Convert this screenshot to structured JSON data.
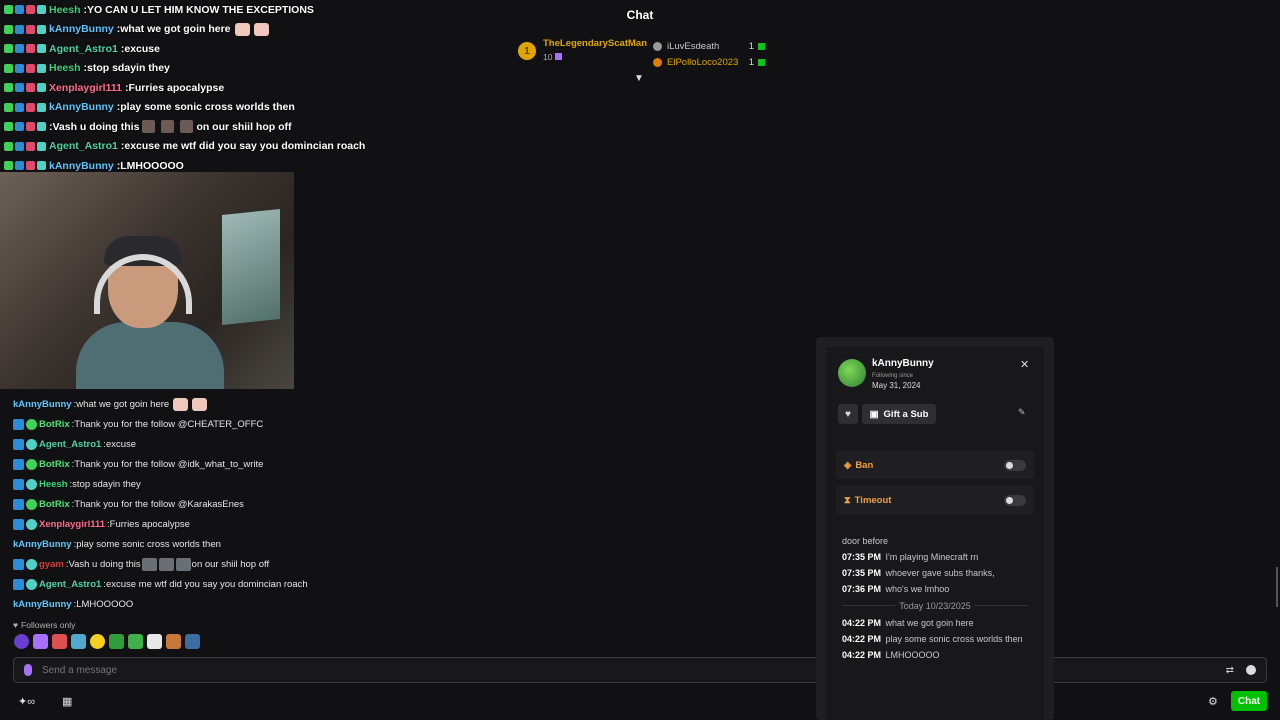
{
  "header": {
    "title": "Chat"
  },
  "overlay_chat": [
    {
      "name": "Heesh",
      "name_color": "#39d17c",
      "text": "YO CAN U LET HIM KNOW THE EXCEPTIONS"
    },
    {
      "name": "kAnnyBunny",
      "name_color": "#5fc6ff",
      "text": "what we got goin here"
    },
    {
      "name": "Agent_Astro1",
      "name_color": "#4fd1a5",
      "text": "excuse"
    },
    {
      "name": "Heesh",
      "name_color": "#39d17c",
      "text": "stop sdayin they"
    },
    {
      "name": "Xenplaygirl111",
      "name_color": "#ff6b8a",
      "text": "Furries apocalypse"
    },
    {
      "name": "kAnnyBunny",
      "name_color": "#5fc6ff",
      "text": "play some sonic cross worlds then"
    },
    {
      "name": "",
      "name_color": "#ffffff",
      "text": "Vash u doing this",
      "text2": "on our shiil hop off"
    },
    {
      "name": "Agent_Astro1",
      "name_color": "#4fd1a5",
      "text": "excuse me wtf did you say you domincian roach"
    },
    {
      "name": "kAnnyBunny",
      "name_color": "#5fc6ff",
      "text": "LMHOOOOO"
    }
  ],
  "leaderboard": {
    "top": {
      "rank": "1",
      "name": "TheLegendaryScatMan",
      "points": "10"
    },
    "others": [
      {
        "name": "iLuvEsdeath",
        "count": "1",
        "name_color": "#c8c8c8",
        "icon_color": "#9a9a9a"
      },
      {
        "name": "ElPolloLoco2023",
        "count": "1",
        "name_color": "#e0a600",
        "icon_color": "#e07a00"
      }
    ]
  },
  "chat_messages": [
    {
      "name": "kAnnyBunny",
      "name_color": "#5fc6ff",
      "text": "what we got goin here"
    },
    {
      "name": "BotRix",
      "name_color": "#54e07a",
      "text": "Thank you for the follow @CHEATER_OFFC"
    },
    {
      "name": "Agent_Astro1",
      "name_color": "#4fd1a5",
      "text": "excuse"
    },
    {
      "name": "BotRix",
      "name_color": "#54e07a",
      "text": "Thank you for the follow @idk_what_to_write"
    },
    {
      "name": "Heesh",
      "name_color": "#39d17c",
      "text": "stop sdayin they"
    },
    {
      "name": "BotRix",
      "name_color": "#54e07a",
      "text": "Thank you for the follow @KarakasEnes"
    },
    {
      "name": "Xenplaygirl111",
      "name_color": "#ff6b8a",
      "text": "Furries apocalypse"
    },
    {
      "name": "kAnnyBunny",
      "name_color": "#5fc6ff",
      "text": "play some sonic cross worlds then"
    },
    {
      "name": "gyam",
      "name_color": "#d83a3a",
      "text": "Vash u doing this",
      "text2": "on our shiil hop off"
    },
    {
      "name": "Agent_Astro1",
      "name_color": "#4fd1a5",
      "text": "excuse me wtf did you say you domincian roach"
    },
    {
      "name": "kAnnyBunny",
      "name_color": "#5fc6ff",
      "text": "LMHOOOOO"
    }
  ],
  "followers_only": "Followers only",
  "send": {
    "placeholder": "Send a message"
  },
  "chat_button": "Chat",
  "user_card": {
    "username": "kAnnyBunny",
    "following_since_label": "Following since",
    "following_date": "May 31, 2024",
    "gift_label": "Gift a Sub",
    "ban_label": "Ban",
    "timeout_label": "Timeout",
    "history_intro": "door before",
    "history": [
      {
        "time": "07:35 PM",
        "text": "I'm playing Minecraft rn"
      },
      {
        "time": "07:35 PM",
        "text": "whoever gave subs thanks,"
      },
      {
        "time": "07:36 PM",
        "text": "who's we lmhoo"
      }
    ],
    "separator": "Today 10/23/2025",
    "history_today": [
      {
        "time": "04:22 PM",
        "text": "what we got goin here"
      },
      {
        "time": "04:22 PM",
        "text": "play some sonic cross worlds then"
      },
      {
        "time": "04:22 PM",
        "text": "LMHOOOOO"
      }
    ]
  }
}
